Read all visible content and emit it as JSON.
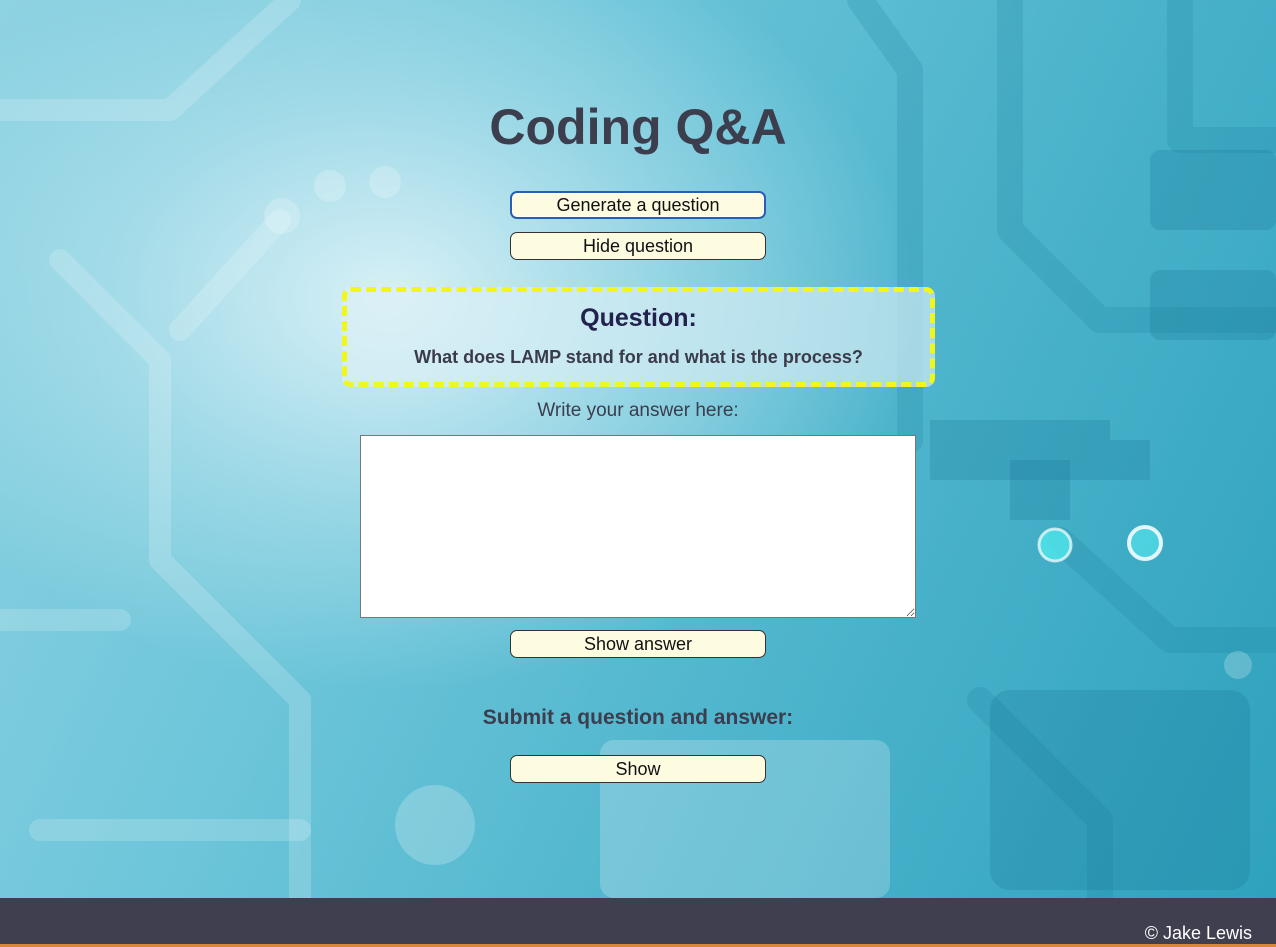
{
  "page": {
    "title": "Coding Q&A"
  },
  "controls": {
    "generate_label": "Generate a question",
    "hide_label": "Hide question"
  },
  "question": {
    "heading": "Question:",
    "text": "What does LAMP stand for and what is the process?"
  },
  "answer": {
    "label": "Write your answer here:",
    "value": "",
    "show_label": "Show answer"
  },
  "submit": {
    "heading": "Submit a question and answer:",
    "show_label": "Show"
  },
  "footer": {
    "copyright": "© Jake Lewis"
  },
  "colors": {
    "button_bg": "#fdfbe0",
    "question_border": "#f2f71a",
    "footer_bg": "#3f3f4f",
    "heading_text": "#3c3d4d"
  }
}
